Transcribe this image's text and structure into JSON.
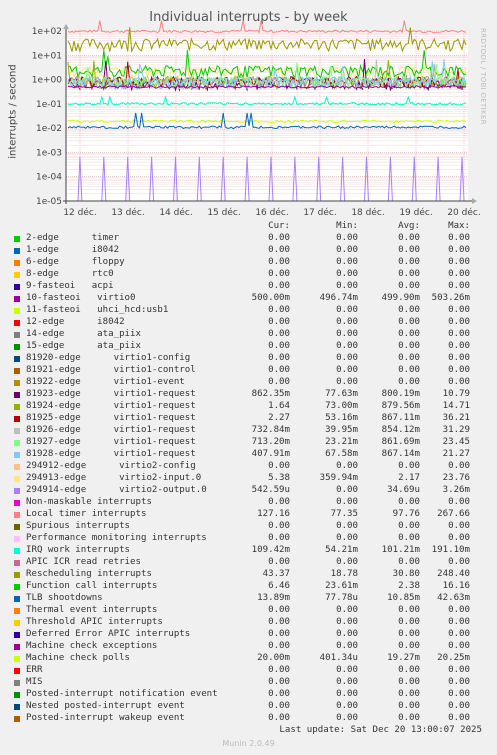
{
  "header": {
    "title": "Individual interrupts - by week",
    "side_label": "RRDTOOL / TOBI OETIKER",
    "footer_update": "Last update: Sat Dec 20 13:00:07 2025",
    "munin_version": "Munin 2.0.49"
  },
  "legend_headers": {
    "cur": "Cur:",
    "min": "Min:",
    "avg": "Avg:",
    "max": "Max:"
  },
  "legend": [
    {
      "name": "2-edge      timer",
      "color": "#00cc00",
      "cur": "0.00",
      "min": "0.00",
      "avg": "0.00",
      "max": "0.00"
    },
    {
      "name": "1-edge      i8042",
      "color": "#0066b3",
      "cur": "0.00",
      "min": "0.00",
      "avg": "0.00",
      "max": "0.00"
    },
    {
      "name": "6-edge      floppy",
      "color": "#ff8000",
      "cur": "0.00",
      "min": "0.00",
      "avg": "0.00",
      "max": "0.00"
    },
    {
      "name": "8-edge      rtc0",
      "color": "#ffcc00",
      "cur": "0.00",
      "min": "0.00",
      "avg": "0.00",
      "max": "0.00"
    },
    {
      "name": "9-fasteoi   acpi",
      "color": "#330099",
      "cur": "0.00",
      "min": "0.00",
      "avg": "0.00",
      "max": "0.00"
    },
    {
      "name": "10-fasteoi   virtio0",
      "color": "#990099",
      "cur": "500.00m",
      "min": "496.74m",
      "avg": "499.90m",
      "max": "503.26m"
    },
    {
      "name": "11-fasteoi   uhci_hcd:usb1",
      "color": "#ccff00",
      "cur": "0.00",
      "min": "0.00",
      "avg": "0.00",
      "max": "0.00"
    },
    {
      "name": "12-edge      i8042",
      "color": "#ff0000",
      "cur": "0.00",
      "min": "0.00",
      "avg": "0.00",
      "max": "0.00"
    },
    {
      "name": "14-edge      ata_piix",
      "color": "#808080",
      "cur": "0.00",
      "min": "0.00",
      "avg": "0.00",
      "max": "0.00"
    },
    {
      "name": "15-edge      ata_piix",
      "color": "#008f00",
      "cur": "0.00",
      "min": "0.00",
      "avg": "0.00",
      "max": "0.00"
    },
    {
      "name": "81920-edge      virtio1-config",
      "color": "#00487d",
      "cur": "0.00",
      "min": "0.00",
      "avg": "0.00",
      "max": "0.00"
    },
    {
      "name": "81921-edge      virtio1-control",
      "color": "#b35a00",
      "cur": "0.00",
      "min": "0.00",
      "avg": "0.00",
      "max": "0.00"
    },
    {
      "name": "81922-edge      virtio1-event",
      "color": "#b38f00",
      "cur": "0.00",
      "min": "0.00",
      "avg": "0.00",
      "max": "0.00"
    },
    {
      "name": "81923-edge      virtio1-request",
      "color": "#6b006b",
      "cur": "862.35m",
      "min": "77.63m",
      "avg": "800.19m",
      "max": "10.79"
    },
    {
      "name": "81924-edge      virtio1-request",
      "color": "#8fb300",
      "cur": "1.64",
      "min": "73.00m",
      "avg": "879.56m",
      "max": "14.71"
    },
    {
      "name": "81925-edge      virtio1-request",
      "color": "#b30000",
      "cur": "2.27",
      "min": "53.16m",
      "avg": "867.11m",
      "max": "36.21"
    },
    {
      "name": "81926-edge      virtio1-request",
      "color": "#bebebe",
      "cur": "732.84m",
      "min": "39.95m",
      "avg": "854.12m",
      "max": "31.29"
    },
    {
      "name": "81927-edge      virtio1-request",
      "color": "#80ff80",
      "cur": "713.20m",
      "min": "23.21m",
      "avg": "861.69m",
      "max": "23.45"
    },
    {
      "name": "81928-edge      virtio1-request",
      "color": "#80c9ff",
      "cur": "407.91m",
      "min": "67.58m",
      "avg": "867.14m",
      "max": "21.27"
    },
    {
      "name": "294912-edge      virtio2-config",
      "color": "#ffc080",
      "cur": "0.00",
      "min": "0.00",
      "avg": "0.00",
      "max": "0.00"
    },
    {
      "name": "294913-edge      virtio2-input.0",
      "color": "#ffe680",
      "cur": "5.38",
      "min": "359.94m",
      "avg": "2.17",
      "max": "23.76"
    },
    {
      "name": "294914-edge      virtio2-output.0",
      "color": "#aa80ff",
      "cur": "542.59u",
      "min": "0.00",
      "avg": "34.69u",
      "max": "3.26m"
    },
    {
      "name": "Non-maskable interrupts",
      "color": "#ee00cc",
      "cur": "0.00",
      "min": "0.00",
      "avg": "0.00",
      "max": "0.00"
    },
    {
      "name": "Local timer interrupts",
      "color": "#ff8080",
      "cur": "127.16",
      "min": "77.35",
      "avg": "97.76",
      "max": "267.66"
    },
    {
      "name": "Spurious interrupts",
      "color": "#666600",
      "cur": "0.00",
      "min": "0.00",
      "avg": "0.00",
      "max": "0.00"
    },
    {
      "name": "Performance monitoring interrupts",
      "color": "#ffbfff",
      "cur": "0.00",
      "min": "0.00",
      "avg": "0.00",
      "max": "0.00"
    },
    {
      "name": "IRQ work interrupts",
      "color": "#00ffcc",
      "cur": "109.42m",
      "min": "54.21m",
      "avg": "101.21m",
      "max": "191.10m"
    },
    {
      "name": "APIC ICR read retries",
      "color": "#cc6699",
      "cur": "0.00",
      "min": "0.00",
      "avg": "0.00",
      "max": "0.00"
    },
    {
      "name": "Rescheduling interrupts",
      "color": "#999900",
      "cur": "43.37",
      "min": "18.78",
      "avg": "30.80",
      "max": "248.40"
    },
    {
      "name": "Function call interrupts",
      "color": "#00cc00",
      "cur": "6.46",
      "min": "23.61m",
      "avg": "2.38",
      "max": "16.16"
    },
    {
      "name": "TLB shootdowns",
      "color": "#0066b3",
      "cur": "13.89m",
      "min": "77.78u",
      "avg": "10.85m",
      "max": "42.63m"
    },
    {
      "name": "Thermal event interrupts",
      "color": "#ff8000",
      "cur": "0.00",
      "min": "0.00",
      "avg": "0.00",
      "max": "0.00"
    },
    {
      "name": "Threshold APIC interrupts",
      "color": "#ffcc00",
      "cur": "0.00",
      "min": "0.00",
      "avg": "0.00",
      "max": "0.00"
    },
    {
      "name": "Deferred Error APIC interrupts",
      "color": "#330099",
      "cur": "0.00",
      "min": "0.00",
      "avg": "0.00",
      "max": "0.00"
    },
    {
      "name": "Machine check exceptions",
      "color": "#990099",
      "cur": "0.00",
      "min": "0.00",
      "avg": "0.00",
      "max": "0.00"
    },
    {
      "name": "Machine check polls",
      "color": "#ccff00",
      "cur": "20.00m",
      "min": "401.34u",
      "avg": "19.27m",
      "max": "20.25m"
    },
    {
      "name": "ERR",
      "color": "#ff0000",
      "cur": "0.00",
      "min": "0.00",
      "avg": "0.00",
      "max": "0.00"
    },
    {
      "name": "MIS",
      "color": "#808080",
      "cur": "0.00",
      "min": "0.00",
      "avg": "0.00",
      "max": "0.00"
    },
    {
      "name": "Posted-interrupt notification event",
      "color": "#008f00",
      "cur": "0.00",
      "min": "0.00",
      "avg": "0.00",
      "max": "0.00"
    },
    {
      "name": "Nested posted-interrupt event",
      "color": "#00487d",
      "cur": "0.00",
      "min": "0.00",
      "avg": "0.00",
      "max": "0.00"
    },
    {
      "name": "Posted-interrupt wakeup event",
      "color": "#b35a00",
      "cur": "0.00",
      "min": "0.00",
      "avg": "0.00",
      "max": "0.00"
    }
  ],
  "chart_data": {
    "type": "line",
    "title": "Individual interrupts - by week",
    "ylabel": "interrupts / second",
    "xlabel": "",
    "yscale": "log",
    "ylim": [
      1e-05,
      100
    ],
    "y_ticks": [
      "1e+02",
      "1e+01",
      "1e+00",
      "1e-01",
      "1e-02",
      "1e-03",
      "1e-04",
      "1e-05"
    ],
    "x_ticks": [
      "12 déc.",
      "13 déc.",
      "14 déc.",
      "15 déc.",
      "16 déc.",
      "17 déc.",
      "18 déc.",
      "19 déc.",
      "20 déc."
    ],
    "grid": true,
    "legend_placement": "bottom",
    "series": [
      {
        "name": "Local timer interrupts",
        "color": "#ff8080",
        "typical": 97.76,
        "min": 77.35,
        "max": 267.66
      },
      {
        "name": "Rescheduling interrupts",
        "color": "#999900",
        "typical": 30.8,
        "min": 18.78,
        "max": 248.4
      },
      {
        "name": "294913-edge      virtio2-input.0",
        "color": "#ffe680",
        "typical": 2.17,
        "min": 0.36,
        "max": 23.76
      },
      {
        "name": "Function call interrupts",
        "color": "#00cc00",
        "typical": 2.38,
        "min": 0.0236,
        "max": 16.16
      },
      {
        "name": "81923-edge      virtio1-request",
        "color": "#6b006b",
        "typical": 0.8,
        "min": 0.0776,
        "max": 10.79
      },
      {
        "name": "81924-edge      virtio1-request",
        "color": "#8fb300",
        "typical": 0.88,
        "min": 0.073,
        "max": 14.71
      },
      {
        "name": "81925-edge      virtio1-request",
        "color": "#b30000",
        "typical": 0.87,
        "min": 0.0532,
        "max": 36.21
      },
      {
        "name": "81926-edge      virtio1-request",
        "color": "#bebebe",
        "typical": 0.85,
        "min": 0.04,
        "max": 31.29
      },
      {
        "name": "81927-edge      virtio1-request",
        "color": "#80ff80",
        "typical": 0.86,
        "min": 0.0232,
        "max": 23.45
      },
      {
        "name": "81928-edge      virtio1-request",
        "color": "#80c9ff",
        "typical": 0.87,
        "min": 0.0676,
        "max": 21.27
      },
      {
        "name": "10-fasteoi   virtio0",
        "color": "#990099",
        "typical": 0.5,
        "min": 0.497,
        "max": 0.503
      },
      {
        "name": "IRQ work interrupts",
        "color": "#00ffcc",
        "typical": 0.101,
        "min": 0.054,
        "max": 0.191
      },
      {
        "name": "Machine check polls",
        "color": "#ccff00",
        "typical": 0.0193,
        "min": 0.0004,
        "max": 0.0203
      },
      {
        "name": "TLB shootdowns",
        "color": "#0066b3",
        "typical": 0.0109,
        "min": 7.78e-05,
        "max": 0.0426
      },
      {
        "name": "294914-edge      virtio2-output.0",
        "color": "#aa80ff",
        "typical": 3.47e-05,
        "min": 0,
        "max": 0.00326
      }
    ]
  }
}
